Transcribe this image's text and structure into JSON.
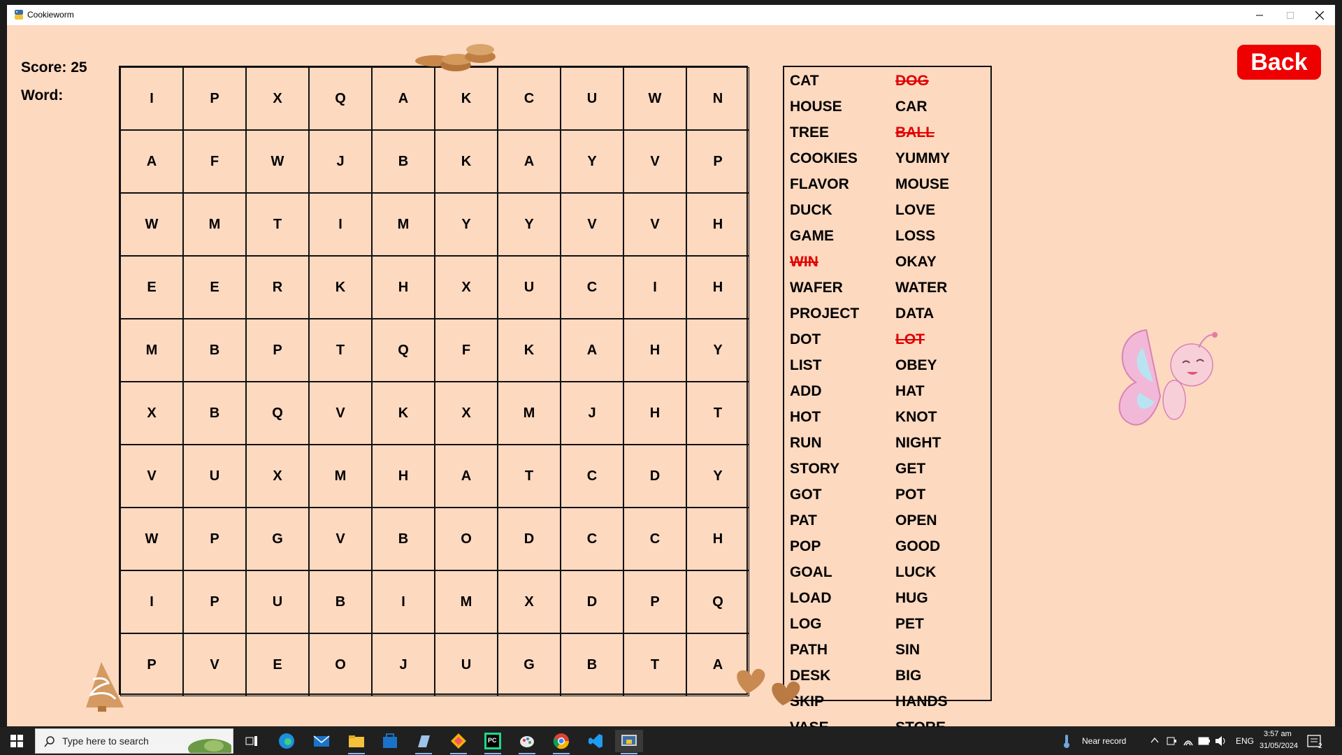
{
  "window": {
    "title": "Cookieworm"
  },
  "score_label": "Score: 25",
  "word_label": "Word:",
  "back_label": "Back",
  "grid": [
    [
      "I",
      "P",
      "X",
      "Q",
      "A",
      "K",
      "C",
      "U",
      "W",
      "N"
    ],
    [
      "A",
      "F",
      "W",
      "J",
      "B",
      "K",
      "A",
      "Y",
      "V",
      "P"
    ],
    [
      "W",
      "M",
      "T",
      "I",
      "M",
      "Y",
      "Y",
      "V",
      "V",
      "H"
    ],
    [
      "E",
      "E",
      "R",
      "K",
      "H",
      "X",
      "U",
      "C",
      "I",
      "H"
    ],
    [
      "M",
      "B",
      "P",
      "T",
      "Q",
      "F",
      "K",
      "A",
      "H",
      "Y"
    ],
    [
      "X",
      "B",
      "Q",
      "V",
      "K",
      "X",
      "M",
      "J",
      "H",
      "T"
    ],
    [
      "V",
      "U",
      "X",
      "M",
      "H",
      "A",
      "T",
      "C",
      "D",
      "Y"
    ],
    [
      "W",
      "P",
      "G",
      "V",
      "B",
      "O",
      "D",
      "C",
      "C",
      "H"
    ],
    [
      "I",
      "P",
      "U",
      "B",
      "I",
      "M",
      "X",
      "D",
      "P",
      "Q"
    ],
    [
      "P",
      "V",
      "E",
      "O",
      "J",
      "U",
      "G",
      "B",
      "T",
      "A"
    ]
  ],
  "words_col1": [
    {
      "w": "CAT",
      "found": false
    },
    {
      "w": "HOUSE",
      "found": false
    },
    {
      "w": "TREE",
      "found": false
    },
    {
      "w": "COOKIES",
      "found": false
    },
    {
      "w": "FLAVOR",
      "found": false
    },
    {
      "w": "DUCK",
      "found": false
    },
    {
      "w": "GAME",
      "found": false
    },
    {
      "w": "WIN",
      "found": true
    },
    {
      "w": "WAFER",
      "found": false
    },
    {
      "w": "PROJECT",
      "found": false
    },
    {
      "w": "DOT",
      "found": false
    },
    {
      "w": "LIST",
      "found": false
    },
    {
      "w": "ADD",
      "found": false
    },
    {
      "w": "HOT",
      "found": false
    },
    {
      "w": "RUN",
      "found": false
    },
    {
      "w": "STORY",
      "found": false
    },
    {
      "w": "GOT",
      "found": false
    },
    {
      "w": "PAT",
      "found": false
    },
    {
      "w": "POP",
      "found": false
    },
    {
      "w": "GOAL",
      "found": false
    },
    {
      "w": "LOAD",
      "found": false
    },
    {
      "w": "LOG",
      "found": false
    },
    {
      "w": "PATH",
      "found": false
    },
    {
      "w": "DESK",
      "found": false
    },
    {
      "w": "SKIP",
      "found": false
    },
    {
      "w": "VASE",
      "found": false
    }
  ],
  "words_col2": [
    {
      "w": "DOG",
      "found": true
    },
    {
      "w": "CAR",
      "found": false
    },
    {
      "w": "BALL",
      "found": true
    },
    {
      "w": "YUMMY",
      "found": false
    },
    {
      "w": "MOUSE",
      "found": false
    },
    {
      "w": "LOVE",
      "found": false
    },
    {
      "w": "LOSS",
      "found": false
    },
    {
      "w": "OKAY",
      "found": false
    },
    {
      "w": "WATER",
      "found": false
    },
    {
      "w": "DATA",
      "found": false
    },
    {
      "w": "LOT",
      "found": true
    },
    {
      "w": "OBEY",
      "found": false
    },
    {
      "w": "HAT",
      "found": false
    },
    {
      "w": "KNOT",
      "found": false
    },
    {
      "w": "NIGHT",
      "found": false
    },
    {
      "w": "GET",
      "found": false
    },
    {
      "w": "POT",
      "found": false
    },
    {
      "w": "OPEN",
      "found": false
    },
    {
      "w": "GOOD",
      "found": false
    },
    {
      "w": "LUCK",
      "found": false
    },
    {
      "w": "HUG",
      "found": false
    },
    {
      "w": "PET",
      "found": false
    },
    {
      "w": "SIN",
      "found": false
    },
    {
      "w": "BIG",
      "found": false
    },
    {
      "w": "HANDS",
      "found": false
    },
    {
      "w": "STORE",
      "found": false
    }
  ],
  "taskbar": {
    "search_placeholder": "Type here to search",
    "weather": "Near record",
    "lang": "ENG",
    "time": "3:57 am",
    "date": "31/05/2024",
    "notifications": "2"
  },
  "colors": {
    "background": "#fdd9c0",
    "accent": "#ee0000",
    "found_word": "#e00000"
  }
}
